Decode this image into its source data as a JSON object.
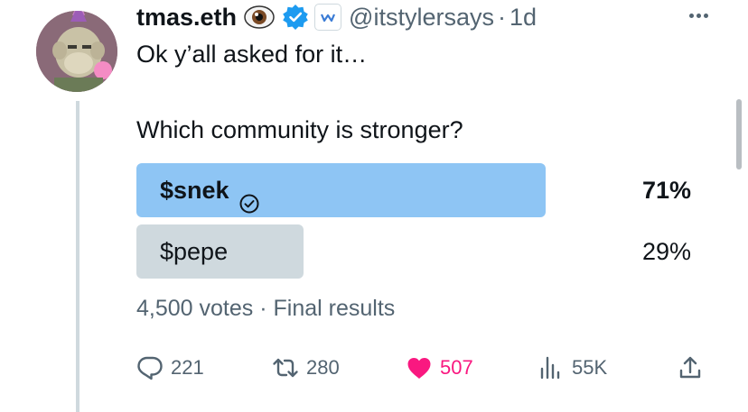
{
  "author": {
    "name": "tmas.eth",
    "handle": "@itstylersays",
    "time": "1d",
    "separator": "·"
  },
  "tweet": {
    "text": "Ok y’all asked for it…"
  },
  "poll": {
    "question": "Which community is stronger?",
    "options": [
      {
        "label": "$snek",
        "percent": "71%",
        "value": 0.71,
        "winner": true,
        "color": "#8ec5f4"
      },
      {
        "label": "$pepe",
        "percent": "29%",
        "value": 0.29,
        "winner": false,
        "color": "#cfd9de"
      }
    ],
    "votes": "4,500 votes",
    "separator": "·",
    "status": "Final results"
  },
  "actions": {
    "replies": "221",
    "reposts": "280",
    "likes": "507",
    "views": "55K"
  },
  "colors": {
    "like": "#f91880",
    "verified": "#1d9bf0",
    "muted": "#536471",
    "text": "#0f1419"
  },
  "icons": [
    "eye-emoji-icon",
    "verified-badge-icon",
    "affiliate-badge-icon",
    "more-icon",
    "check-circle-icon",
    "reply-icon",
    "repost-icon",
    "like-icon",
    "views-icon",
    "share-icon"
  ]
}
